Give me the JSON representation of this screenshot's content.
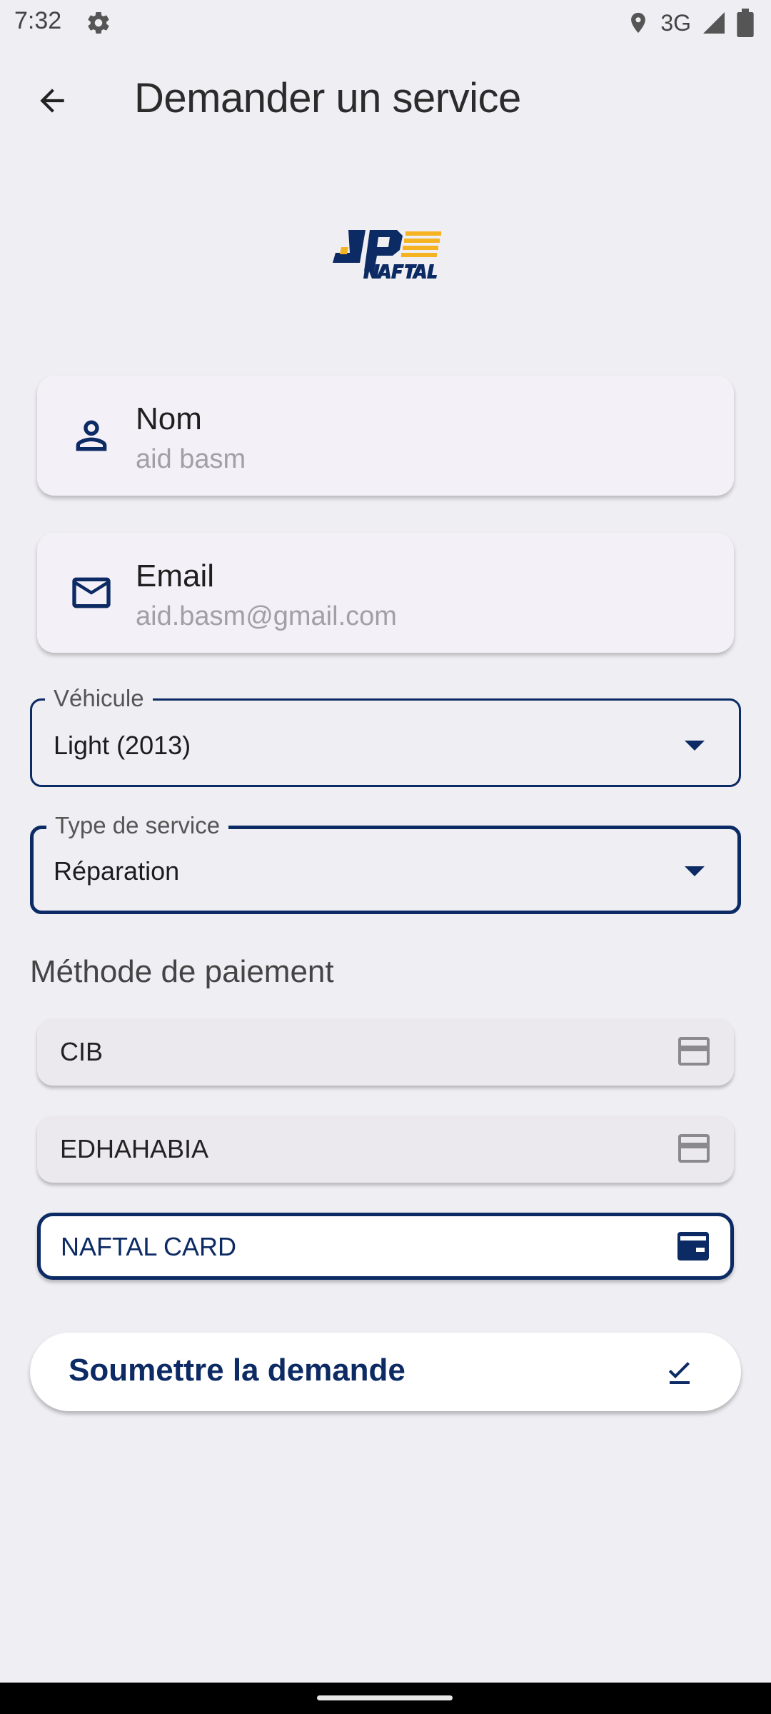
{
  "status_bar": {
    "time": "7:32",
    "network": "3G",
    "icons": [
      "settings-icon",
      "location-icon",
      "signal-icon",
      "battery-icon"
    ]
  },
  "app_bar": {
    "title": "Demander un service",
    "back_icon": "arrow-left-icon"
  },
  "logo": {
    "alt": "NAFTAL"
  },
  "user_info": {
    "name_label": "Nom",
    "name_value": "aid basm",
    "email_label": "Email",
    "email_value": "aid.basm@gmail.com"
  },
  "form": {
    "vehicle_label": "Véhicule",
    "vehicle_value": "Light (2013)",
    "service_label": "Type de service",
    "service_value": "Réparation"
  },
  "payment": {
    "title": "Méthode de paiement",
    "options": [
      {
        "label": "CIB",
        "selected": false
      },
      {
        "label": "EDHAHABIA",
        "selected": false
      },
      {
        "label": "NAFTAL CARD",
        "selected": true
      }
    ]
  },
  "submit": {
    "label": "Soumettre la demande"
  },
  "colors": {
    "primary": "#0c2a63",
    "background": "#eeeef3",
    "card": "#f4f0f7",
    "logo_yellow": "#f5b321"
  }
}
